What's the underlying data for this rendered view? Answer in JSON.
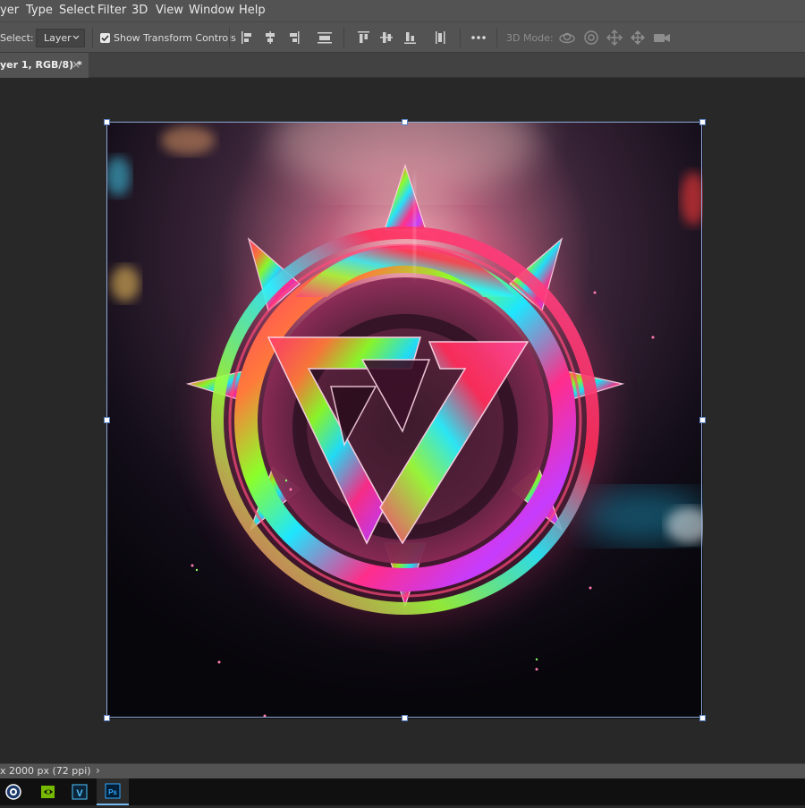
{
  "menu": {
    "items": [
      "yer",
      "Type",
      "Select",
      "Filter",
      "3D",
      "View",
      "Window",
      "Help"
    ]
  },
  "options_bar": {
    "select_label": "Select:",
    "select_value": "Layer",
    "show_transform_label": "Show Transform Controls",
    "show_transform_checked": true,
    "mode_3d_label": "3D Mode:"
  },
  "document_tab": {
    "title": "yer 1, RGB/8) *",
    "close_glyph": "×"
  },
  "status_bar": {
    "text": "x 2000 px (72 ppi)",
    "arrow": "›"
  },
  "taskbar": {
    "apps": [
      {
        "name": "Cinema 4D",
        "icon": "cinema4d-icon"
      },
      {
        "name": "NVIDIA",
        "icon": "nvidia-icon"
      },
      {
        "name": "Vegas",
        "icon": "vegas-icon"
      },
      {
        "name": "Photoshop",
        "icon": "photoshop-icon",
        "text": "Ps",
        "active": true
      }
    ]
  },
  "colors": {
    "ui_panel": "#535353",
    "canvas_bg": "#282828",
    "selection": "#8ea9d6",
    "accent_pink": "#ff2d8a",
    "accent_cyan": "#1ee6ff",
    "accent_green": "#8cff2a"
  }
}
